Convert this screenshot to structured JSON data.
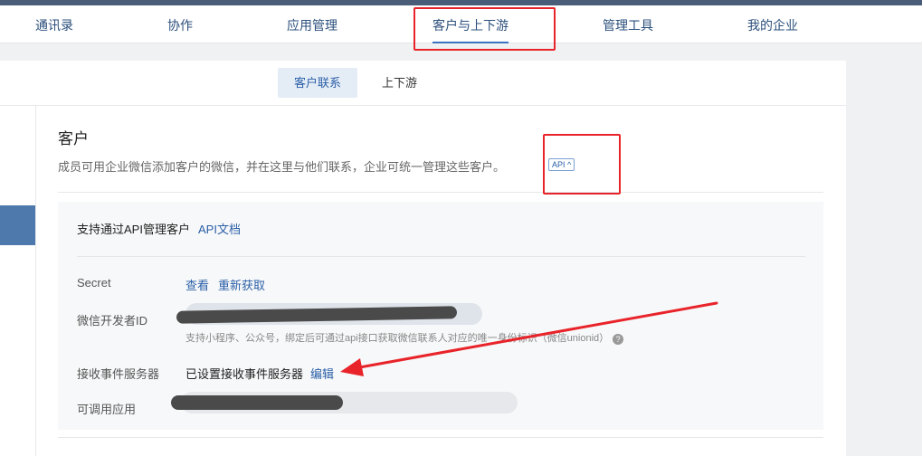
{
  "nav": {
    "items": [
      {
        "label": "通讯录"
      },
      {
        "label": "协作"
      },
      {
        "label": "应用管理"
      },
      {
        "label": "客户与上下游"
      },
      {
        "label": "管理工具"
      },
      {
        "label": "我的企业"
      }
    ],
    "active_index": 3
  },
  "subtabs": [
    {
      "label": "客户联系",
      "selected": true
    },
    {
      "label": "上下游",
      "selected": false
    }
  ],
  "section": {
    "title": "客户",
    "description": "成员可用企业微信添加客户的微信，并在这里与他们联系，企业可统一管理这些客户。",
    "api_tag": "API ^"
  },
  "api_card": {
    "title": "支持通过API管理客户",
    "doc_link": "API文档",
    "rows": {
      "secret": {
        "label": "Secret",
        "view": "查看",
        "refresh": "重新获取"
      },
      "dev_id": {
        "label": "微信开发者ID",
        "hint": "支持小程序、公众号，绑定后可通过api接口获取微信联系人对应的唯一身份标识（微信unionid）"
      },
      "event_server": {
        "label": "接收事件服务器",
        "value": "已设置接收事件服务器",
        "edit": "编辑"
      },
      "apps": {
        "label": "可调用应用"
      }
    }
  },
  "colors": {
    "accent": "#2b5fa8",
    "annotation": "#e8242a",
    "topbar": "#4a5d78"
  },
  "icons": {
    "help": "question-circle-icon",
    "arrow": "annotation-arrow"
  }
}
